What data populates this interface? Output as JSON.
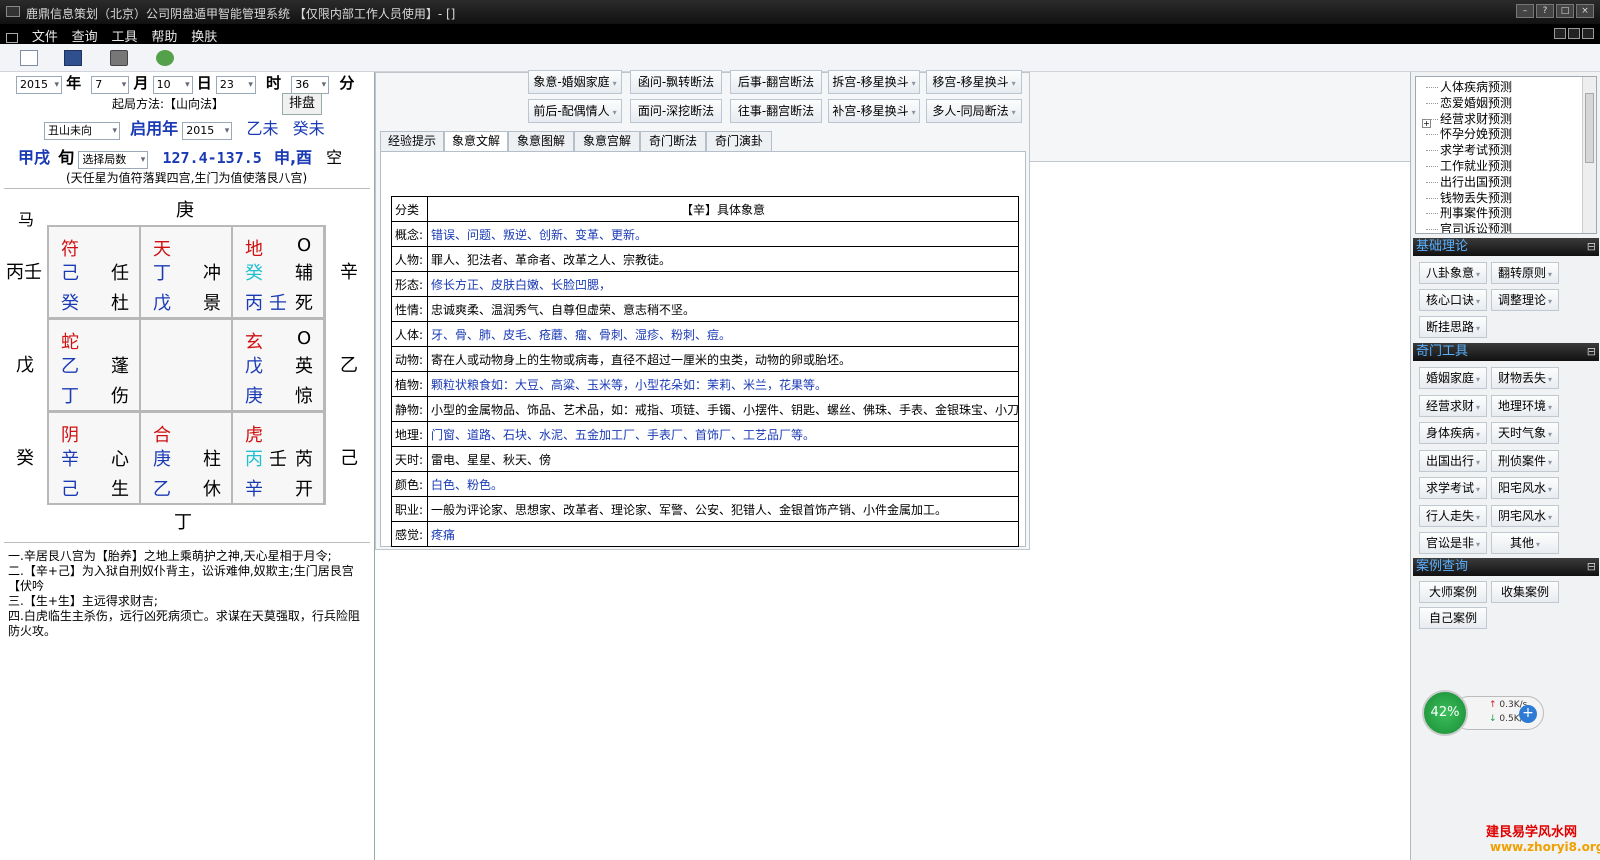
{
  "window": {
    "title": "鹿鼎信息策划（北京）公司阴盘遁甲智能管理系统   【仅限内部工作人员使用】- []",
    "menu": [
      "文件",
      "查询",
      "工具",
      "帮助",
      "换肤"
    ]
  },
  "left": {
    "year_val": "2015",
    "year_unit": "年",
    "month_val": "7",
    "month_unit": "月",
    "day_val": "10",
    "day_unit": "日",
    "hour_val": "23",
    "hour_unit": "时",
    "minute_val": "36",
    "minute_unit": "分",
    "method_label": "起局方法:【山向法】",
    "arrange_button": "排盘",
    "mountain_select": "丑山未向",
    "qiyong_label": "启用年",
    "qiyong_year": "2015",
    "gz1": "乙未",
    "gz2": "癸未",
    "xun": "甲戌",
    "xun_unit": "旬",
    "ju_select": "选择局数",
    "degree": "127.4-137.5",
    "kong_branches": "申,酉",
    "kong_label": "空",
    "desc": "(天任星为值符落巽四宫,生门为值使落艮八宫)",
    "ma": "马",
    "dir_top": "庚",
    "dir_left_top": "丙壬",
    "dir_left_mid": "戊",
    "dir_left_bot": "癸",
    "dir_right_top": "辛",
    "dir_right_mid": "乙",
    "dir_right_bot": "己",
    "dir_bottom": "丁",
    "palaces": {
      "p4": {
        "god": "符",
        "s1": "己",
        "star": "任",
        "s2": "癸",
        "door": "杜"
      },
      "p9": {
        "god": "天",
        "s1": "丁",
        "star": "冲",
        "s2": "戊",
        "door": "景"
      },
      "p2": {
        "god": "地",
        "mark": "O",
        "s1": "癸",
        "star": "辅",
        "s2a": "丙",
        "s2b": "壬",
        "door": "死"
      },
      "p3": {
        "god": "蛇",
        "s1": "乙",
        "star": "蓬",
        "s2": "丁",
        "door": "伤"
      },
      "p7": {
        "god": "玄",
        "mark": "O",
        "s1": "戊",
        "star": "英",
        "s2": "庚",
        "door": "惊"
      },
      "p8": {
        "god": "阴",
        "s1": "辛",
        "star": "心",
        "s2": "己",
        "door": "生"
      },
      "p1": {
        "god": "合",
        "s1": "庚",
        "star": "柱",
        "s2": "乙",
        "door": "休"
      },
      "p6": {
        "god": "虎",
        "s1a": "丙",
        "s1b": "壬",
        "star": "芮",
        "s2": "辛",
        "door": "开"
      }
    },
    "analysis": [
      "一.辛居艮八宫为【胎养】之地上乘萌护之神,天心星相于月令;",
      "二.【辛+己】为入狱自刑奴仆背主，讼诉难伸,奴欺主;生门居艮宫【伏吟",
      "三.【生+生】主远得求财吉;",
      "四.白虎临生主杀伤，远行凶死病须亡。求谋在天莫强取，行兵险阻防火攻。"
    ]
  },
  "middle": {
    "buttons_row1": [
      "象意-婚姻家庭",
      "函问-飘转断法",
      "后事-翻宫断法",
      "拆宫-移星换斗",
      "移宫-移星换斗"
    ],
    "buttons_row2": [
      "前后-配偶情人",
      "面问-深挖断法",
      "往事-翻宫断法",
      "补宫-移星换斗",
      "多人-同局断法"
    ],
    "tabs": [
      "经验提示",
      "象意文解",
      "象意图解",
      "象意宫解",
      "奇门断法",
      "奇门演卦"
    ],
    "table_header": {
      "k": "分类",
      "v": "【辛】具体象意"
    },
    "table_rows": [
      {
        "k": "概念:",
        "v": "错误、问题、叛逆、创新、变革、更新。",
        "blue": true
      },
      {
        "k": "人物:",
        "v": "罪人、犯法者、革命者、改革之人、宗教徒。",
        "blue": false
      },
      {
        "k": "形态:",
        "v": "修长方正、皮肤白嫩、长脸凹腮，",
        "blue": true
      },
      {
        "k": "性情:",
        "v": "忠诚爽柔、温润秀气、自尊但虚荣、意志稍不坚。",
        "blue": false
      },
      {
        "k": "人体:",
        "v": "牙、骨、肺、皮毛、疮蘑、瘤、骨刺、湿疹、粉刺、痘。",
        "blue": true
      },
      {
        "k": "动物:",
        "v": "寄在人或动物身上的生物或病毒，直径不超过一厘米的虫类，动物的卵或胎坯。",
        "blue": false
      },
      {
        "k": "植物:",
        "v": "颗粒状粮食如：大豆、高粱、玉米等，小型花朵如：茉莉、米兰，花果等。",
        "blue": true
      },
      {
        "k": "静物:",
        "v": "小型的金属物品、饰品、艺术品，如：戒指、项链、手镯、小摆件、钥匙、螺丝、佛珠、手表、金银珠宝、小刀、",
        "blue": false
      },
      {
        "k": "地理:",
        "v": "门窗、道路、石块、水泥、五金加工厂、手表厂、首饰厂、工艺品厂等。",
        "blue": true
      },
      {
        "k": "天时:",
        "v": "雷电、星星、秋天、傍",
        "blue": false
      },
      {
        "k": "颜色:",
        "v": "白色、粉色。",
        "blue": true
      },
      {
        "k": "职业:",
        "v": "一般为评论家、思想家、改革者、理论家、军警、公安、犯错人、金银首饰产销、小件金属加工。",
        "blue": false
      },
      {
        "k": "感觉:",
        "v": "疼痛",
        "blue": true
      }
    ]
  },
  "right": {
    "tree_items": [
      "人体疾病预测",
      "恋爱婚姻预测",
      "经营求财预测",
      "怀孕分娩预测",
      "求学考试预测",
      "工作就业预测",
      "出行出国预测",
      "钱物丢失预测",
      "刑事案件预测",
      "官司诉讼预测"
    ],
    "sec1": "基础理论",
    "sec1_buttons": [
      "八卦象意",
      "翻转原则",
      "核心口诀",
      "调整理论",
      "断挂思路"
    ],
    "sec2": "奇门工具",
    "sec2_buttons": [
      "婚姻家庭",
      "财物丢失",
      "经营求财",
      "地理环境",
      "身体疾病",
      "天时气象",
      "出国出行",
      "刑侦案件",
      "求学考试",
      "阳宅风水",
      "行人走失",
      "阴宅风水",
      "官讼是非",
      "其他"
    ],
    "sec3": "案例查询",
    "sec3_buttons": [
      "大师案例",
      "收集案例",
      "自己案例"
    ]
  },
  "netmon": {
    "percent": "42%",
    "up": "0.3K/s",
    "down": "0.5K/s"
  },
  "watermark": {
    "line1": "建艮易学风水网",
    "line2": "www.zhoryi8.org"
  },
  "colors": {
    "titlebar": "#1a1a1a",
    "section_header_text": "#5ab0ff",
    "star_blue": "#1a3ab5",
    "god_red": "#d01010"
  }
}
